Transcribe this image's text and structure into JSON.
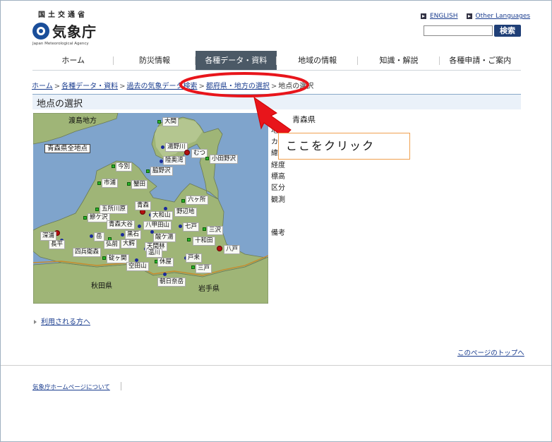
{
  "header": {
    "ministry": "国土交通省",
    "agency_name": "気象庁",
    "agency_en": "Japan Meteorological Agency",
    "lang_english": "ENGLISH",
    "lang_other": "Other Languages",
    "search_button": "検索"
  },
  "nav": {
    "items": [
      "ホーム",
      "防災情報",
      "各種データ・資料",
      "地域の情報",
      "知識・解説",
      "各種申請・ご案内"
    ],
    "active_index": 2
  },
  "breadcrumb": {
    "items": [
      "ホーム",
      "各種データ・資料",
      "過去の気象データ検索",
      "都府県・地方の選択"
    ],
    "current": "地点の選択"
  },
  "page_title": "地点の選択",
  "map": {
    "region_label": "青森県全地点",
    "places": {
      "hakodate_region": "渡島地方",
      "akita": "秋田県",
      "iwate": "岩手県",
      "ooma": "大間",
      "yugano": "湯野川",
      "mutsu": "むつ",
      "mutsu_ogawara": "小田野沢",
      "kanita": "今別",
      "wakinosawa": "脇野沢",
      "hakkouda": "陸奥湾",
      "shiura": "市浦",
      "kanagi": "蟹田",
      "rokkasho": "六ヶ所",
      "goshogawara": "五所川原",
      "aomori": "青森",
      "noheji": "野辺地",
      "ajigasawa": "鰺ケ沢",
      "aomori_ootani": "青森大谷",
      "hakkoda_san": "八甲田山",
      "owani_wa": "大和山",
      "shichinohe": "七戸",
      "misawa": "三沢",
      "fukaura": "深浦",
      "dake": "岳",
      "kuroishi": "黒石",
      "sukayu": "酸ケ湯",
      "towada": "十和田",
      "hachinohe": "八戸",
      "nagahira": "長平",
      "hirosaki": "弘前",
      "owani": "大鰐",
      "tsugaru_nishi": "碇ヶ関",
      "ikarigaseki": "四兵衛森",
      "kamikita": "十和田",
      "tenma": "天間林",
      "kiyosato": "温川",
      "tono": "戸来",
      "sannohe": "三戸",
      "kuroishi_yu": "空田山",
      "kyuya": "休屋",
      "asahi": "朝日奈岳"
    }
  },
  "info": {
    "prefecture": "青森県",
    "labels": [
      "地",
      "カ",
      "緯",
      "経度",
      "標高",
      "区分",
      "観測",
      "備考"
    ]
  },
  "links": {
    "users": "利用される方へ",
    "page_top": "このページのトップへ",
    "about": "気象庁ホームページについて"
  },
  "annotation": {
    "callout_text": "ここをクリック",
    "highlight_color": "#e8151b"
  }
}
